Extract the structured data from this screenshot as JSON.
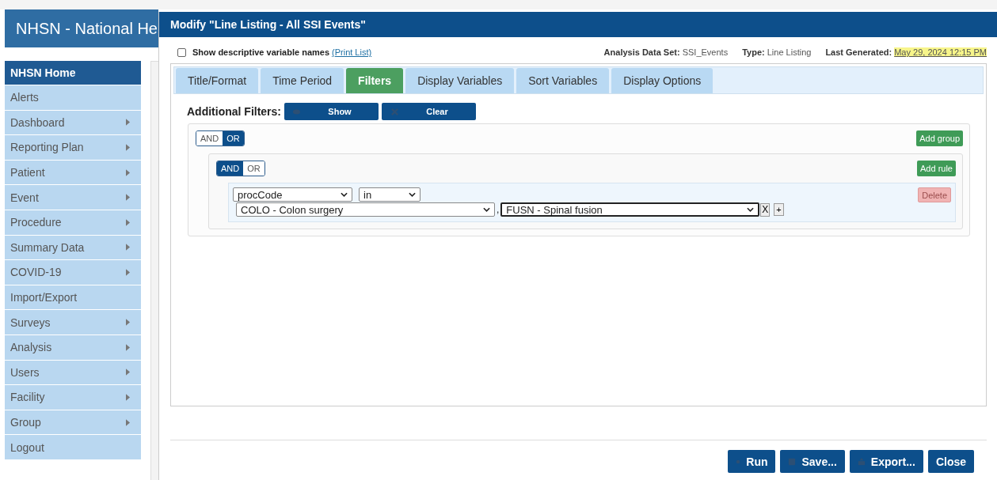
{
  "app_header": {
    "title": "NHSN - National He"
  },
  "sidebar": {
    "items": [
      {
        "label": "NHSN Home",
        "selected": true,
        "has_submenu": false
      },
      {
        "label": "Alerts",
        "selected": false,
        "has_submenu": false
      },
      {
        "label": "Dashboard",
        "selected": false,
        "has_submenu": true
      },
      {
        "label": "Reporting Plan",
        "selected": false,
        "has_submenu": true
      },
      {
        "label": "Patient",
        "selected": false,
        "has_submenu": true
      },
      {
        "label": "Event",
        "selected": false,
        "has_submenu": true
      },
      {
        "label": "Procedure",
        "selected": false,
        "has_submenu": true
      },
      {
        "label": "Summary Data",
        "selected": false,
        "has_submenu": true
      },
      {
        "label": "COVID-19",
        "selected": false,
        "has_submenu": true
      },
      {
        "label": "Import/Export",
        "selected": false,
        "has_submenu": false
      },
      {
        "label": "Surveys",
        "selected": false,
        "has_submenu": true
      },
      {
        "label": "Analysis",
        "selected": false,
        "has_submenu": true
      },
      {
        "label": "Users",
        "selected": false,
        "has_submenu": true
      },
      {
        "label": "Facility",
        "selected": false,
        "has_submenu": true
      },
      {
        "label": "Group",
        "selected": false,
        "has_submenu": true
      },
      {
        "label": "Logout",
        "selected": false,
        "has_submenu": false
      }
    ]
  },
  "dialog": {
    "title": "Modify \"Line Listing - All SSI Events\"",
    "descriptive_names": {
      "label": "Show descriptive variable names",
      "checked": false,
      "link": "(Print List)"
    },
    "info": [
      {
        "label": "Analysis Data Set:",
        "value": "SSI_Events",
        "highlighted": false
      },
      {
        "label": "Type:",
        "value": "Line Listing",
        "highlighted": false
      },
      {
        "label": "Last Generated:",
        "value": "May 29, 2024 12:15 PM",
        "highlighted": true
      }
    ],
    "tabs": [
      {
        "label": "Title/Format",
        "selected": false
      },
      {
        "label": "Time Period",
        "selected": false
      },
      {
        "label": "Filters",
        "selected": true
      },
      {
        "label": "Display Variables",
        "selected": false
      },
      {
        "label": "Sort Variables",
        "selected": false
      },
      {
        "label": "Display Options",
        "selected": false
      }
    ],
    "filters": {
      "label": "Additional Filters:",
      "buttons": [
        {
          "label": "Show"
        },
        {
          "label": "Clear"
        }
      ],
      "group": {
        "conditions": [
          {
            "label": "AND",
            "selected": false
          },
          {
            "label": "OR",
            "selected": true
          }
        ],
        "add_button": "Add group",
        "group": {
          "conditions": [
            {
              "label": "AND",
              "selected": true
            },
            {
              "label": "OR",
              "selected": false
            }
          ],
          "add_button": "Add rule",
          "rules": [
            {
              "field": "procCode",
              "operator": "in",
              "values": [
                {
                  "text": "COLO - Colon surgery",
                  "focused": false
                },
                {
                  "text": "FUSN - Spinal fusion",
                  "focused": true
                }
              ],
              "separator": ",",
              "remove": "X",
              "add": "+",
              "delete": "Delete"
            }
          ]
        }
      }
    },
    "footer_buttons": [
      {
        "label": "Run"
      },
      {
        "label": "Save..."
      },
      {
        "label": "Export..."
      },
      {
        "label": "Close"
      }
    ]
  }
}
